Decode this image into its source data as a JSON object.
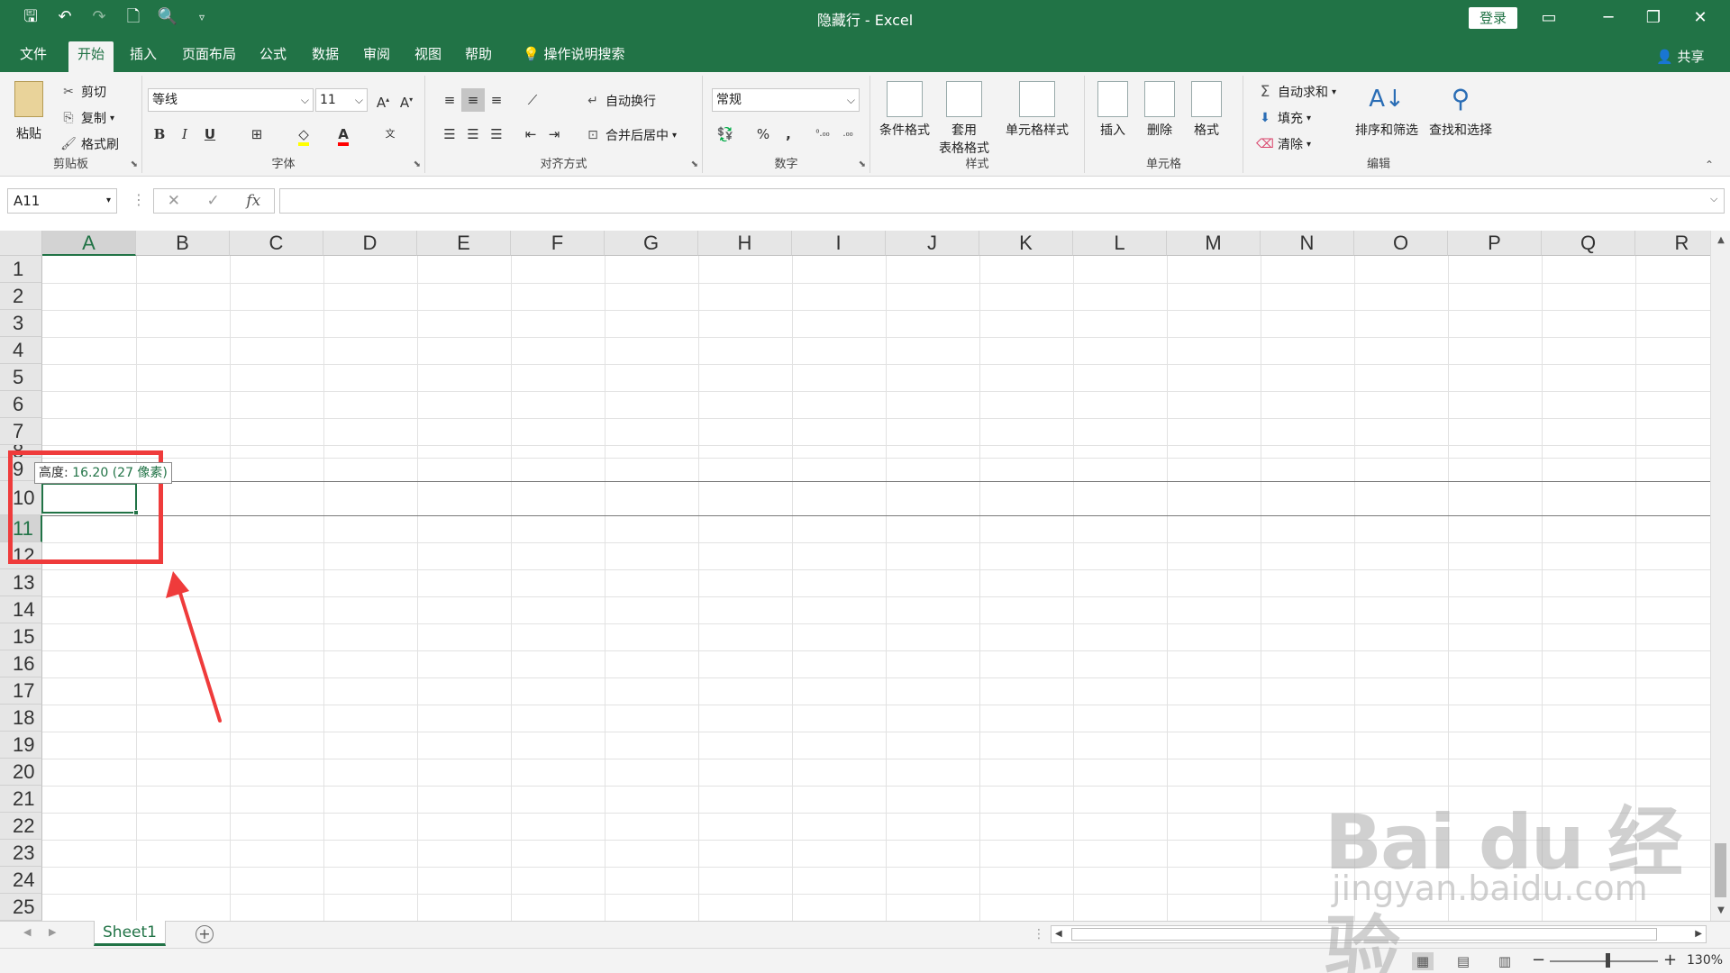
{
  "window": {
    "title": "隐藏行 - Excel",
    "login_label": "登录",
    "qat_icons": [
      "save-icon",
      "undo-icon",
      "redo-icon",
      "new-file-icon",
      "print-preview-icon",
      "customize-qat-icon"
    ]
  },
  "menu": {
    "tabs": [
      "文件",
      "开始",
      "插入",
      "页面布局",
      "公式",
      "数据",
      "审阅",
      "视图",
      "帮助"
    ],
    "active_tab": "开始",
    "tell_me": "操作说明搜索",
    "share": "共享"
  },
  "ribbon": {
    "clipboard": {
      "label": "剪贴板",
      "paste": "粘贴",
      "cut": "剪切",
      "copy": "复制",
      "format_painter": "格式刷"
    },
    "font": {
      "label": "字体",
      "font_name": "等线",
      "font_size": "11",
      "bold": "B",
      "italic": "I",
      "underline": "U"
    },
    "alignment": {
      "label": "对齐方式",
      "wrap_text": "自动换行",
      "merge_center": "合并后居中"
    },
    "number": {
      "label": "数字",
      "format": "常规",
      "percent": "%",
      "comma": ","
    },
    "styles": {
      "label": "样式",
      "conditional": "条件格式",
      "table_top": "套用",
      "table_bottom": "表格格式",
      "cell_styles": "单元格样式"
    },
    "cells": {
      "label": "单元格",
      "insert": "插入",
      "delete": "删除",
      "format": "格式"
    },
    "editing": {
      "label": "编辑",
      "autosum": "自动求和",
      "fill": "填充",
      "clear": "清除",
      "sort_filter": "排序和筛选",
      "find_select": "查找和选择"
    }
  },
  "formula_bar": {
    "name_box": "A11",
    "cancel": "✕",
    "enter": "✓",
    "fx": "fx",
    "content": ""
  },
  "grid": {
    "columns": [
      "A",
      "B",
      "C",
      "D",
      "E",
      "F",
      "G",
      "H",
      "I",
      "J",
      "K",
      "L",
      "M",
      "N",
      "O",
      "P",
      "Q",
      "R"
    ],
    "rows": [
      "1",
      "2",
      "3",
      "4",
      "5",
      "6",
      "7",
      "8",
      "9",
      "10",
      "11",
      "12",
      "13",
      "14",
      "15",
      "16",
      "17",
      "18",
      "19",
      "20",
      "21",
      "22",
      "23",
      "24",
      "25"
    ],
    "active_column": "A",
    "active_row": "11",
    "tooltip_label": "高度: ",
    "tooltip_value": "16.20 (27 像素)"
  },
  "sheets": {
    "tabs": [
      "Sheet1"
    ],
    "add": "+"
  },
  "status": {
    "zoom": "130%",
    "zoom_minus": "−",
    "zoom_plus": "+",
    "zoom_level": 0.52
  },
  "annotation": {
    "color": "#ef3b3b"
  },
  "watermark": {
    "text": "Bai du 经验",
    "url": "jingyan.baidu.com"
  },
  "colors": {
    "accent": "#217346",
    "annotation": "#ef3b3b"
  }
}
